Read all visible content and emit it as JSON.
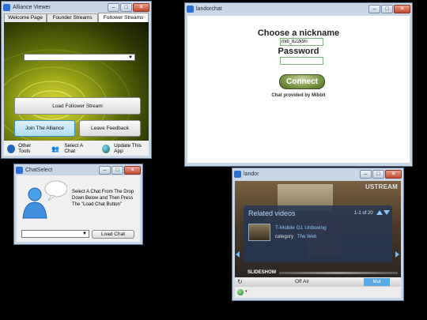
{
  "alliance": {
    "title": "Alliance Viewer",
    "tabs": [
      "Welcome Page",
      "Founder Streams",
      "Follower Streams"
    ],
    "load_button": "Load Follower Stream",
    "join_button": "Join The Alliance",
    "feedback_button": "Leave Feedback",
    "bottom": {
      "other_tools": "Other Tools",
      "select_chat": "Select A Chat",
      "update_app": "Update This App"
    }
  },
  "landor_chat": {
    "title": "landorchat",
    "heading": "Choose a nickname",
    "nickname_value": "mib_822k9n",
    "password_label": "Password",
    "connect_button": "Connect",
    "footer": "Chat provided by Mibbit"
  },
  "chatselect": {
    "title": "ChatSelect",
    "instructions": "Select A Chat From The Drop Down Below and Then Press The \"Load Chat Button\"",
    "load_button": "Load Chat"
  },
  "landor": {
    "title": "landor",
    "brand": "USTREAM",
    "related_heading": "Related videos",
    "pager": "1-1 of 20",
    "video_title": "T-Mobile G1 Unboxing",
    "category_label": "category",
    "category_value": "The Web",
    "slideshow": "SLIDESHOW",
    "status": "Off Air",
    "mute_button": "Mut"
  },
  "colors": {
    "accent_blue": "#3d7be0",
    "connect_green": "#6e8a3a",
    "title_bar": "#c9d6e6"
  }
}
